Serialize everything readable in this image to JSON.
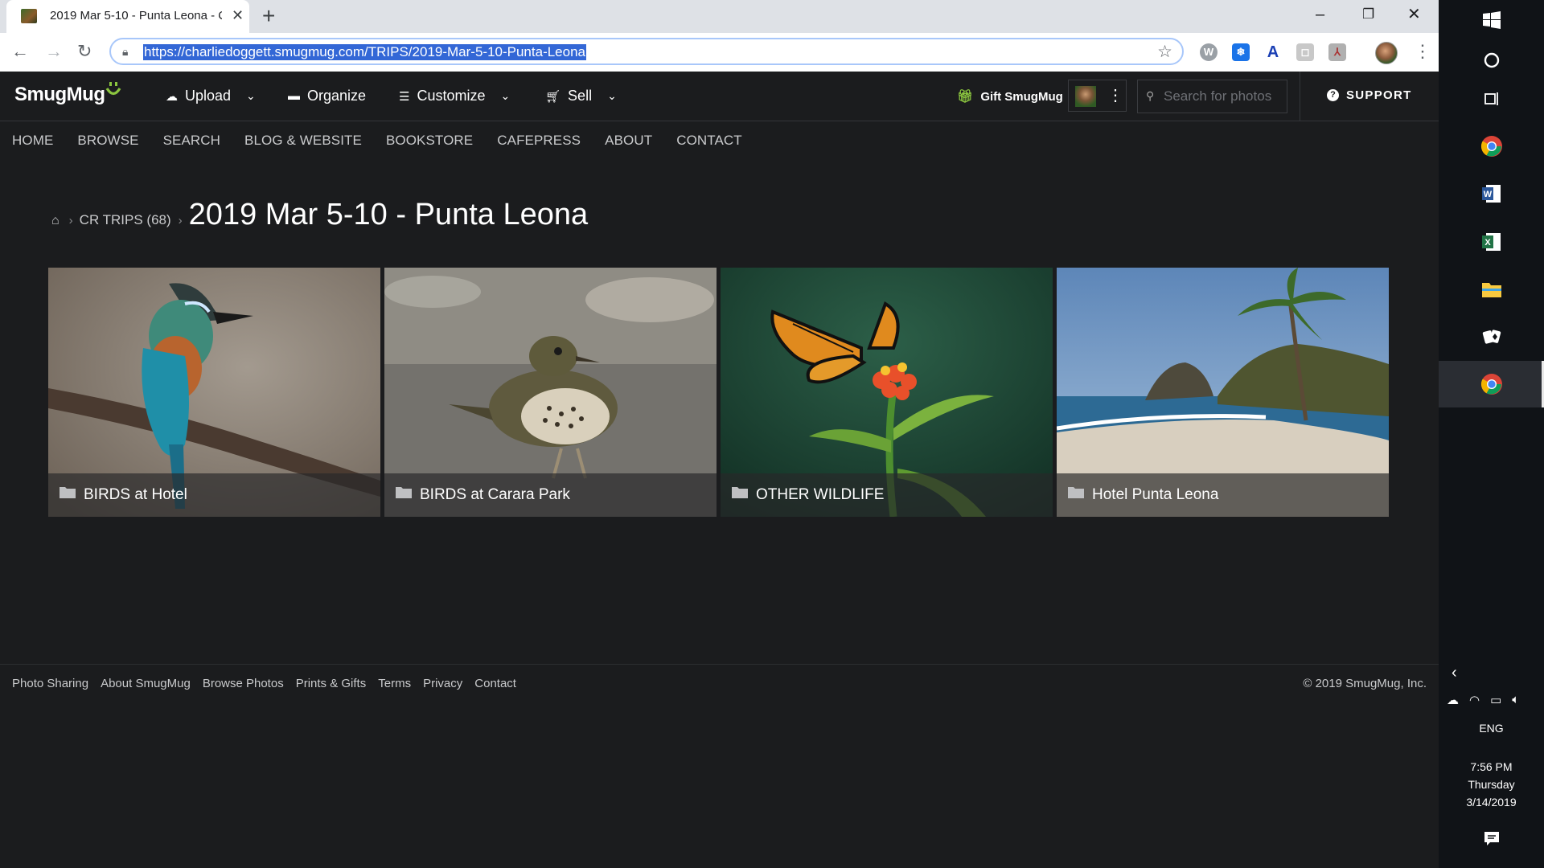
{
  "browser": {
    "tab_title": "2019 Mar 5-10 - Punta Leona - C",
    "url": "https://charliedoggett.smugmug.com/TRIPS/2019-Mar-5-10-Punta-Leona",
    "extensions": [
      "W",
      "❄",
      "A",
      "◻",
      "⅄"
    ]
  },
  "header": {
    "logo_text": "SmugMug",
    "nav": [
      {
        "label": "Upload",
        "icon": "cloud-upload-icon",
        "has_menu": true
      },
      {
        "label": "Organize",
        "icon": "folder-icon",
        "has_menu": false
      },
      {
        "label": "Customize",
        "icon": "sliders-icon",
        "has_menu": true
      },
      {
        "label": "Sell",
        "icon": "cart-icon",
        "has_menu": true
      }
    ],
    "gift_label": "Gift SmugMug",
    "search_placeholder": "Search for photos",
    "support_label": "SUPPORT"
  },
  "site_nav": [
    "HOME",
    "BROWSE",
    "SEARCH",
    "BLOG & WEBSITE",
    "BOOKSTORE",
    "CAFEPRESS",
    "ABOUT",
    "CONTACT"
  ],
  "breadcrumb": {
    "parent": "CR TRIPS (68)",
    "title": "2019 Mar 5-10 - Punta Leona"
  },
  "gallery": [
    {
      "label": "BIRDS at Hotel",
      "scene": "turquoise-browed motmot on branch"
    },
    {
      "label": "BIRDS at Carara Park",
      "scene": "thrush on ground"
    },
    {
      "label": "OTHER WILDLIFE",
      "scene": "monarch butterfly on milkweed"
    },
    {
      "label": "Hotel Punta Leona",
      "scene": "beach with palm trees"
    }
  ],
  "footer": {
    "links": [
      "Photo Sharing",
      "About SmugMug",
      "Browse Photos",
      "Prints & Gifts",
      "Terms",
      "Privacy",
      "Contact"
    ],
    "copyright": "© 2019 SmugMug, Inc."
  },
  "taskbar": {
    "language": "ENG",
    "time": "7:56 PM",
    "day": "Thursday",
    "date": "3/14/2019"
  },
  "colors": {
    "page_bg": "#1b1c1e",
    "accent_green": "#8bc53f",
    "url_highlight": "#3367d6"
  }
}
